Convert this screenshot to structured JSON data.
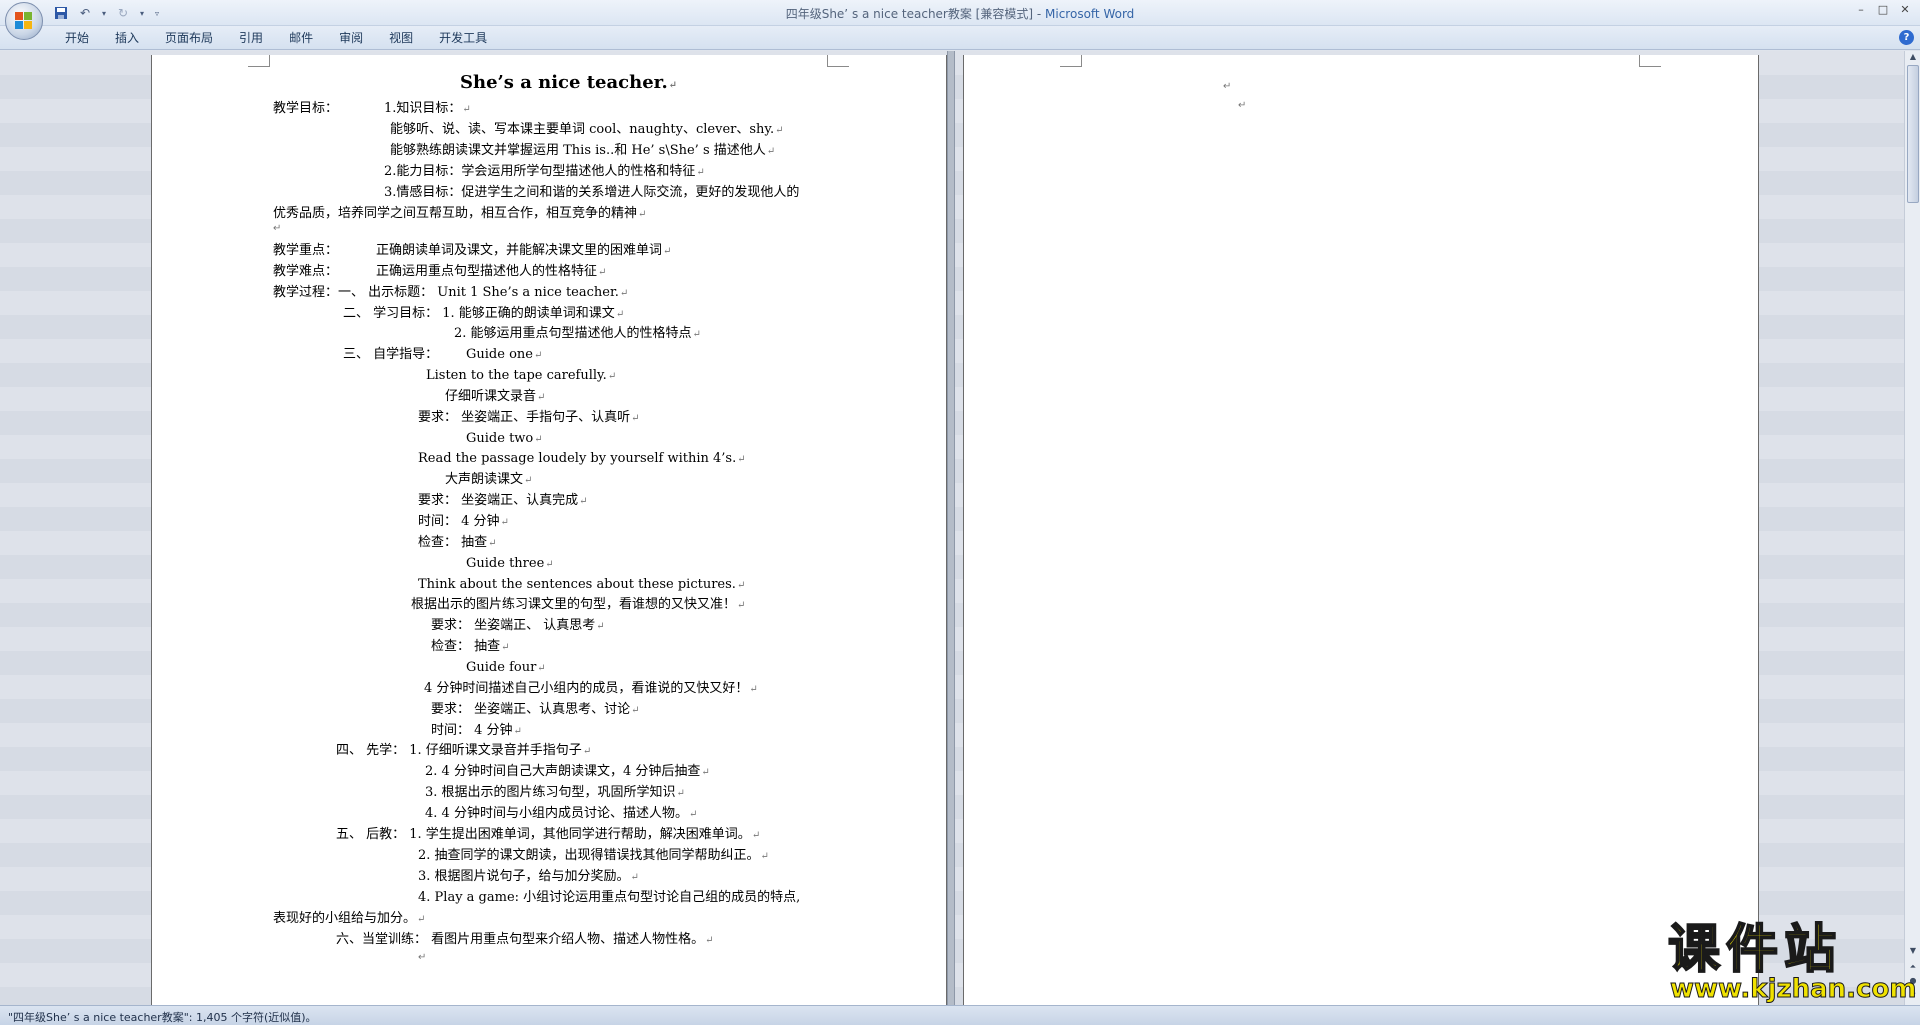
{
  "window": {
    "title_doc": "四年级She’ s a nice teacher教案 [兼容模式] - ",
    "title_app": "Microsoft Word"
  },
  "ribbon": {
    "tabs": [
      "开始",
      "插入",
      "页面布局",
      "引用",
      "邮件",
      "审阅",
      "视图",
      "开发工具"
    ]
  },
  "statusbar": {
    "text": "\"四年级She’ s a nice teacher教案\": 1,405 个字符(近似值)。"
  },
  "document": {
    "title": "She’s a nice teacher.",
    "lines": [
      "教学目标：",
      "1.知识目标：",
      "能够听、说、读、写本课主要单词 cool、naughty、clever、shy.",
      "能够熟练朗读课文并掌握运用 This   is..和   He’ s\\She’ s 描述他人",
      "2.能力目标：学会运用所学句型描述他人的性格和特征",
      "3.情感目标：促进学生之间和谐的关系增进人际交流，更好的发现他人的",
      "优秀品质，培养同学之间互帮互助，相互合作，相互竞争的精神",
      "教学重点：",
      "正确朗读单词及课文，并能解决课文里的困难单词",
      "教学难点：",
      "正确运用重点句型描述他人的性格特征",
      "教学过程：一、  出示标题：   Unit 1 She’s a nice teacher.",
      "二、  学习目标：  1.  能够正确的朗读单词和课文",
      "2.  能够运用重点句型描述他人的性格特点",
      "三、  自学指导：",
      "Guide    one",
      "Listen to the tape carefully.",
      "仔细听课文录音",
      "要求：  坐姿端正、手指句子、认真听",
      "Guide    two",
      "Read the passage loudely by yourself within 4’s.",
      "大声朗读课文",
      "要求：  坐姿端正、认真完成",
      "时间：  4 分钟",
      "检查：  抽查",
      "Guide    three",
      "Think about the sentences about these pictures.",
      "根据出示的图片练习课文里的句型，看谁想的又快又准！",
      "要求：  坐姿端正、 认真思考",
      "检查：    抽查",
      "Guide    four",
      "4 分钟时间描述自己小组内的成员，看谁说的又快又好！",
      "要求：    坐姿端正、认真思考、讨论",
      "时间：    4 分钟",
      "四、  先学：    1.  仔细听课文录音并手指句子",
      "2. 4 分钟时间自己大声朗读课文，4 分钟后抽查",
      "3.  根据出示的图片练习句型，巩固所学知识",
      "4. 4 分钟时间与小组内成员讨论、描述人物。",
      "五、  后教：  1.    学生提出困难单词，其他同学进行帮助，解决困难单词。",
      "2.    抽查同学的课文朗读，出现得错误找其他同学帮助纠正。",
      "3.    根据图片说句子，给与加分奖励。",
      "4.    Play  a  game:  小组讨论运用重点句型讨论自己组的成员的特点,",
      "表现好的小组给与加分。",
      "六、当堂训练：   看图片用重点句型来介绍人物、描述人物性格。"
    ]
  },
  "watermark": {
    "title": "课件站",
    "url": "www.kjzhan.com"
  }
}
